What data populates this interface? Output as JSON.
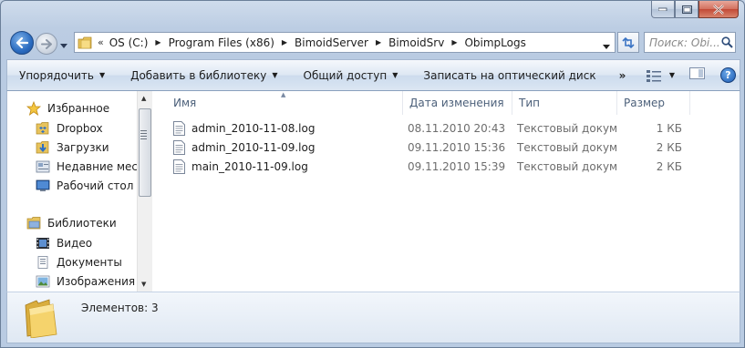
{
  "window": {
    "caption": {
      "minimize": "",
      "maximize": "",
      "close": ""
    }
  },
  "address": {
    "overflow": "«",
    "crumbs": [
      "OS (C:)",
      "Program Files (x86)",
      "BimoidServer",
      "BimoidSrv",
      "ObimpLogs"
    ],
    "search_placeholder": "Поиск: Obi..."
  },
  "toolbar": {
    "organize": "Упорядочить",
    "add_to_library": "Добавить в библиотеку",
    "share": "Общий доступ",
    "burn": "Записать на оптический диск",
    "more": "»",
    "help": "?"
  },
  "nav": {
    "favorites": {
      "label": "Избранное",
      "items": [
        "Dropbox",
        "Загрузки",
        "Недавние места",
        "Рабочий стол"
      ]
    },
    "libraries": {
      "label": "Библиотеки",
      "items": [
        "Видео",
        "Документы",
        "Изображения"
      ]
    }
  },
  "files": {
    "columns": {
      "name": "Имя",
      "date": "Дата изменения",
      "type": "Тип",
      "size": "Размер"
    },
    "rows": [
      {
        "name": "admin_2010-11-08.log",
        "date": "08.11.2010 20:43",
        "type": "Текстовый докум...",
        "size": "1 КБ"
      },
      {
        "name": "admin_2010-11-09.log",
        "date": "09.11.2010 15:36",
        "type": "Текстовый докум...",
        "size": "2 КБ"
      },
      {
        "name": "main_2010-11-09.log",
        "date": "09.11.2010 15:39",
        "type": "Текстовый докум...",
        "size": "2 КБ"
      }
    ]
  },
  "details": {
    "count": "Элементов: 3"
  },
  "colors": {
    "accent": "#2a6bc0",
    "header_text": "#4c607a",
    "secondary_text": "#6d6d6d"
  }
}
